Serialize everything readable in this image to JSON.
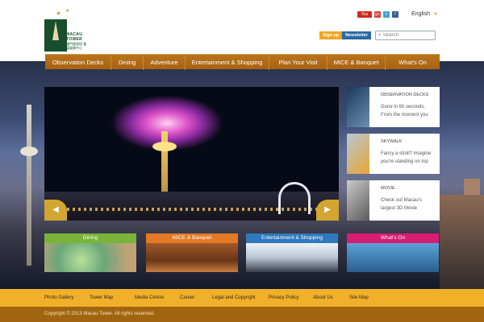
{
  "brand": {
    "logo_text_en": "MACAU TOWER",
    "logo_text_cjk": "澳門旅遊塔 會展娛樂中心"
  },
  "header": {
    "social": [
      "YouTube",
      "Google+",
      "Twitter",
      "Facebook"
    ],
    "language": "English",
    "signup_label": "Sign up",
    "newsletter_label": "Newsletter",
    "search_placeholder": "Search"
  },
  "nav": {
    "items": [
      "Observation Decks",
      "Dining",
      "Adventure",
      "Entertainment & Shopping",
      "Plan Your Visit",
      "MICE & Banquet",
      "What's On"
    ]
  },
  "side_cards": [
    {
      "title": "OBSERVATION DECKS",
      "desc": "Gone in 60 seconds. From the moment you"
    },
    {
      "title": "SKYWALK",
      "desc": "Fancy a stroll? Imagine you're standing on top"
    },
    {
      "title": "MOVIE",
      "desc": "Check out Macau's largest 3D Movie"
    }
  ],
  "tiles": [
    {
      "label": "Dining",
      "color": "#7ab33a"
    },
    {
      "label": "MICE & Banquet",
      "color": "#e37a24"
    },
    {
      "label": "Entertainment & Shopping",
      "color": "#2f79bd"
    },
    {
      "label": "What's On",
      "color": "#d71c74"
    }
  ],
  "footer": {
    "links": [
      "Photo Gallery",
      "Tower Map",
      "Media Centre",
      "Career",
      "Legal and Copyright",
      "Privacy Policy",
      "About Us",
      "Site Map"
    ],
    "copyright": "Copyright © 2013 Macau Tower. All rights reserved."
  },
  "colors": {
    "nav": "#ad6716",
    "footer_top": "#f0b02a",
    "footer_bottom": "#a2650f"
  }
}
